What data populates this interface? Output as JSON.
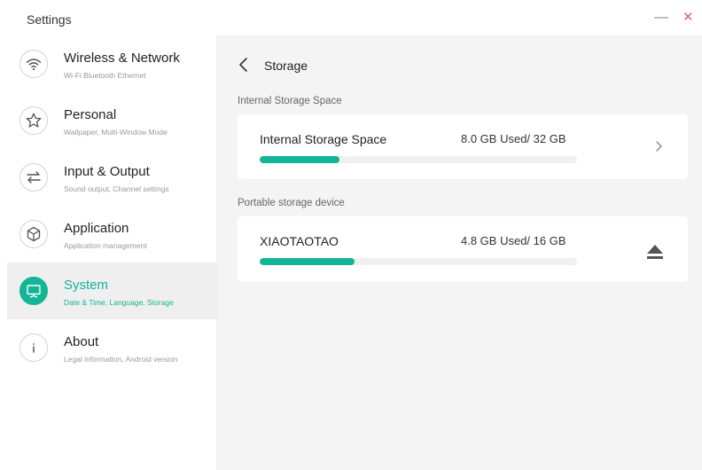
{
  "window": {
    "title": "Settings",
    "minimize_symbol": "—",
    "close_symbol": "✕"
  },
  "sidebar": {
    "items": [
      {
        "icon": "wifi-icon",
        "title": "Wireless & Network",
        "subtitle": "Wi-Fi Bluetooth Ethernet",
        "active": false
      },
      {
        "icon": "star-icon",
        "title": "Personal",
        "subtitle": "Wallpaper, Multi-Window Mode",
        "active": false
      },
      {
        "icon": "swap-arrows-icon",
        "title": "Input & Output",
        "subtitle": "Sound output, Channel settings",
        "active": false
      },
      {
        "icon": "cube-icon",
        "title": "Application",
        "subtitle": "Application management",
        "active": false
      },
      {
        "icon": "monitor-icon",
        "title": "System",
        "subtitle": "Date & Time, Language, Storage",
        "active": true
      },
      {
        "icon": "info-icon",
        "title": "About",
        "subtitle": "Legal information, Android version",
        "active": false
      }
    ]
  },
  "main": {
    "page_title": "Storage",
    "sections": [
      {
        "label": "Internal Storage Space",
        "card": {
          "name": "Internal Storage Space",
          "usage": "8.0 GB Used/ 32 GB",
          "used_fraction": 0.25,
          "action_icon": "chevron-right-icon"
        }
      },
      {
        "label": "Portable storage device",
        "card": {
          "name": "XIAOTAOTAO",
          "usage": "4.8 GB Used/ 16 GB",
          "used_fraction": 0.3,
          "action_icon": "eject-icon"
        }
      }
    ]
  },
  "colors": {
    "accent": "#14b496",
    "panel_bg": "#f4f4f4",
    "selected_item_bg": "#efefef",
    "close": "#e06565"
  }
}
